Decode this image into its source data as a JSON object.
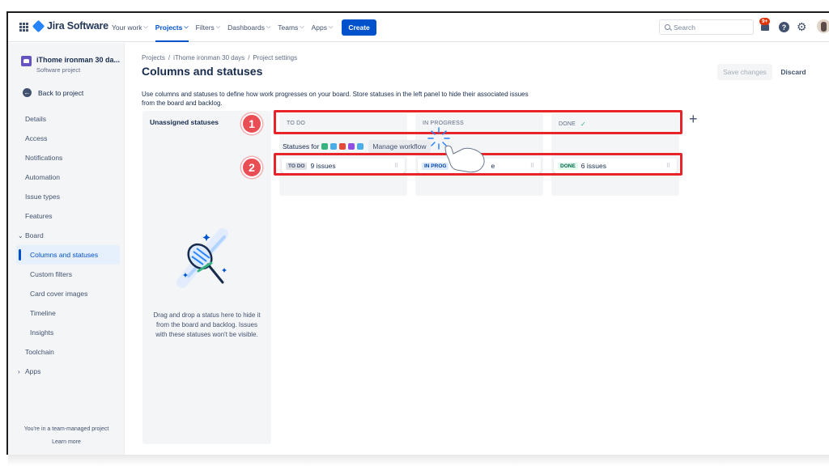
{
  "nav": {
    "app_name": "Jira Software",
    "items": [
      {
        "label": "Your work",
        "active": false
      },
      {
        "label": "Projects",
        "active": true
      },
      {
        "label": "Filters",
        "active": false
      },
      {
        "label": "Dashboards",
        "active": false
      },
      {
        "label": "Teams",
        "active": false
      },
      {
        "label": "Apps",
        "active": false
      }
    ],
    "create_label": "Create",
    "search_placeholder": "Search",
    "notification_badge": "9+",
    "help_glyph": "?",
    "settings_glyph": "⚙"
  },
  "sidebar": {
    "project_name": "iThome ironman 30 da...",
    "project_type": "Software project",
    "back_label": "Back to project",
    "items": {
      "details": "Details",
      "access": "Access",
      "notifications": "Notifications",
      "automation": "Automation",
      "issue_types": "Issue types",
      "features": "Features",
      "board": "Board",
      "columns_statuses": "Columns and statuses",
      "custom_filters": "Custom filters",
      "card_cover_images": "Card cover images",
      "timeline": "Timeline",
      "insights": "Insights",
      "toolchain": "Toolchain",
      "apps": "Apps"
    },
    "footer_text": "You're in a team-managed project",
    "learn_more": "Learn more"
  },
  "main": {
    "breadcrumbs": [
      "Projects",
      "iThome ironman 30 days",
      "Project settings"
    ],
    "title": "Columns and statuses",
    "save_label": "Save changes",
    "discard_label": "Discard",
    "description": "Use columns and statuses to define how work progresses on your board. Store statuses in the left panel to hide their associated issues from the board and backlog.",
    "unassigned_title": "Unassigned statuses",
    "unassigned_help": "Drag and drop a status here to hide it from the board and backlog. Issues with these statuses won't be visible.",
    "statuses_for_label": "Statuses for",
    "manage_workflow_label": "Manage workflow",
    "columns": [
      {
        "header": "TO DO",
        "status": "TO DO",
        "issues": "9 issues"
      },
      {
        "header": "IN PROGRESS",
        "status": "IN PROG",
        "issues": "e"
      },
      {
        "header": "DONE",
        "status": "DONE",
        "issues": "6 issues"
      }
    ],
    "done_check": "✓",
    "add_column_glyph": "+"
  },
  "annotations": {
    "marker_1": "1",
    "marker_2": "2",
    "color": "#e8242b"
  },
  "colors": {
    "accent": "#0052cc",
    "logo": "#2684ff",
    "badge": "#de350b"
  }
}
